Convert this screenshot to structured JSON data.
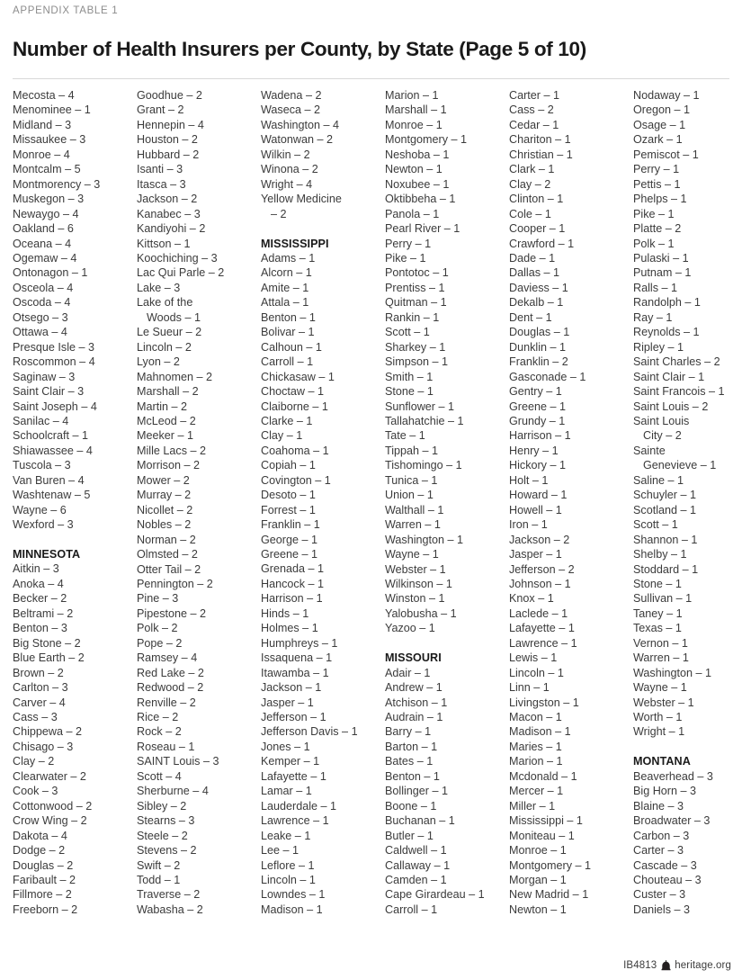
{
  "header": {
    "eyebrow": "APPENDIX TABLE 1",
    "title": "Number of Health Insurers per County, by State (Page 5 of 10)"
  },
  "footer": {
    "doc_id": "IB4813",
    "site": "heritage.org",
    "logo_icon": "heritage-bell-icon"
  },
  "columns": [
    {
      "id": "column-1",
      "entries": [
        {
          "text": "Mecosta – 4"
        },
        {
          "text": "Menominee – 1"
        },
        {
          "text": "Midland – 3"
        },
        {
          "text": "Missaukee – 3"
        },
        {
          "text": "Monroe – 4"
        },
        {
          "text": "Montcalm – 5"
        },
        {
          "text": "Montmorency – 3"
        },
        {
          "text": "Muskegon – 3"
        },
        {
          "text": "Newaygo – 4"
        },
        {
          "text": "Oakland – 6"
        },
        {
          "text": "Oceana – 4"
        },
        {
          "text": "Ogemaw – 4"
        },
        {
          "text": "Ontonagon – 1"
        },
        {
          "text": "Osceola – 4"
        },
        {
          "text": "Oscoda – 4"
        },
        {
          "text": "Otsego – 3"
        },
        {
          "text": "Ottawa – 4"
        },
        {
          "text": "Presque Isle – 3"
        },
        {
          "text": "Roscommon – 4"
        },
        {
          "text": "Saginaw – 3"
        },
        {
          "text": "Saint Clair – 3"
        },
        {
          "text": "Saint Joseph – 4"
        },
        {
          "text": "Sanilac – 4"
        },
        {
          "text": "Schoolcraft – 1"
        },
        {
          "text": "Shiawassee – 4"
        },
        {
          "text": "Tuscola – 3"
        },
        {
          "text": "Van Buren – 4"
        },
        {
          "text": "Washtenaw – 5"
        },
        {
          "text": "Wayne – 6"
        },
        {
          "text": "Wexford – 3"
        },
        {
          "type": "spacer",
          "text": ""
        },
        {
          "type": "state",
          "text": "MINNESOTA"
        },
        {
          "text": "Aitkin – 3"
        },
        {
          "text": "Anoka – 4"
        },
        {
          "text": "Becker – 2"
        },
        {
          "text": "Beltrami – 2"
        },
        {
          "text": "Benton – 3"
        },
        {
          "text": "Big Stone – 2"
        },
        {
          "text": "Blue Earth – 2"
        },
        {
          "text": "Brown – 2"
        },
        {
          "text": "Carlton – 3"
        },
        {
          "text": "Carver – 4"
        },
        {
          "text": "Cass – 3"
        },
        {
          "text": "Chippewa – 2"
        },
        {
          "text": "Chisago – 3"
        },
        {
          "text": "Clay – 2"
        },
        {
          "text": "Clearwater – 2"
        },
        {
          "text": "Cook – 3"
        },
        {
          "text": "Cottonwood – 2"
        },
        {
          "text": "Crow Wing – 2"
        },
        {
          "text": "Dakota – 4"
        },
        {
          "text": "Dodge – 2"
        },
        {
          "text": "Douglas – 2"
        },
        {
          "text": "Faribault – 2"
        },
        {
          "text": "Fillmore – 2"
        },
        {
          "text": "Freeborn – 2"
        }
      ]
    },
    {
      "id": "column-2",
      "entries": [
        {
          "text": "Goodhue – 2"
        },
        {
          "text": "Grant – 2"
        },
        {
          "text": "Hennepin – 4"
        },
        {
          "text": "Houston – 2"
        },
        {
          "text": "Hubbard – 2"
        },
        {
          "text": "Isanti – 3"
        },
        {
          "text": "Itasca – 3"
        },
        {
          "text": "Jackson – 2"
        },
        {
          "text": "Kanabec – 3"
        },
        {
          "text": "Kandiyohi – 2"
        },
        {
          "text": "Kittson – 1"
        },
        {
          "text": "Koochiching – 3"
        },
        {
          "text": "Lac Qui Parle – 2"
        },
        {
          "text": "Lake – 3"
        },
        {
          "text": "Lake of the"
        },
        {
          "type": "cont",
          "text": "Woods – 1"
        },
        {
          "text": "Le Sueur – 2"
        },
        {
          "text": "Lincoln – 2"
        },
        {
          "text": "Lyon – 2"
        },
        {
          "text": "Mahnomen – 2"
        },
        {
          "text": "Marshall – 2"
        },
        {
          "text": "Martin – 2"
        },
        {
          "text": "McLeod – 2"
        },
        {
          "text": "Meeker – 1"
        },
        {
          "text": "Mille Lacs – 2"
        },
        {
          "text": "Morrison – 2"
        },
        {
          "text": "Mower – 2"
        },
        {
          "text": "Murray – 2"
        },
        {
          "text": "Nicollet – 2"
        },
        {
          "text": "Nobles – 2"
        },
        {
          "text": "Norman – 2"
        },
        {
          "text": "Olmsted – 2"
        },
        {
          "text": "Otter Tail – 2"
        },
        {
          "text": "Pennington – 2"
        },
        {
          "text": "Pine – 3"
        },
        {
          "text": "Pipestone – 2"
        },
        {
          "text": "Polk – 2"
        },
        {
          "text": "Pope – 2"
        },
        {
          "text": "Ramsey – 4"
        },
        {
          "text": "Red Lake – 2"
        },
        {
          "text": "Redwood – 2"
        },
        {
          "text": "Renville – 2"
        },
        {
          "text": "Rice – 2"
        },
        {
          "text": "Rock – 2"
        },
        {
          "text": "Roseau – 1"
        },
        {
          "text": "SAINT Louis – 3"
        },
        {
          "text": "Scott – 4"
        },
        {
          "text": "Sherburne – 4"
        },
        {
          "text": "Sibley – 2"
        },
        {
          "text": "Stearns – 3"
        },
        {
          "text": "Steele – 2"
        },
        {
          "text": "Stevens – 2"
        },
        {
          "text": "Swift – 2"
        },
        {
          "text": "Todd – 1"
        },
        {
          "text": "Traverse – 2"
        },
        {
          "text": "Wabasha – 2"
        }
      ]
    },
    {
      "id": "column-3",
      "entries": [
        {
          "text": "Wadena – 2"
        },
        {
          "text": "Waseca – 2"
        },
        {
          "text": "Washington – 4"
        },
        {
          "text": "Watonwan – 2"
        },
        {
          "text": "Wilkin – 2"
        },
        {
          "text": "Winona – 2"
        },
        {
          "text": "Wright – 4"
        },
        {
          "text": "Yellow Medicine"
        },
        {
          "type": "cont",
          "text": "– 2"
        },
        {
          "type": "spacer",
          "text": ""
        },
        {
          "type": "state",
          "text": "MISSISSIPPI"
        },
        {
          "text": "Adams – 1"
        },
        {
          "text": "Alcorn – 1"
        },
        {
          "text": "Amite – 1"
        },
        {
          "text": "Attala – 1"
        },
        {
          "text": "Benton – 1"
        },
        {
          "text": "Bolivar – 1"
        },
        {
          "text": "Calhoun – 1"
        },
        {
          "text": "Carroll – 1"
        },
        {
          "text": "Chickasaw – 1"
        },
        {
          "text": "Choctaw – 1"
        },
        {
          "text": "Claiborne – 1"
        },
        {
          "text": "Clarke – 1"
        },
        {
          "text": "Clay – 1"
        },
        {
          "text": "Coahoma – 1"
        },
        {
          "text": "Copiah – 1"
        },
        {
          "text": "Covington – 1"
        },
        {
          "text": "Desoto – 1"
        },
        {
          "text": "Forrest – 1"
        },
        {
          "text": "Franklin – 1"
        },
        {
          "text": "George – 1"
        },
        {
          "text": "Greene – 1"
        },
        {
          "text": "Grenada – 1"
        },
        {
          "text": "Hancock – 1"
        },
        {
          "text": "Harrison – 1"
        },
        {
          "text": "Hinds – 1"
        },
        {
          "text": "Holmes – 1"
        },
        {
          "text": "Humphreys – 1"
        },
        {
          "text": "Issaquena – 1"
        },
        {
          "text": "Itawamba – 1"
        },
        {
          "text": "Jackson – 1"
        },
        {
          "text": "Jasper – 1"
        },
        {
          "text": "Jefferson – 1"
        },
        {
          "text": "Jefferson Davis – 1"
        },
        {
          "text": "Jones – 1"
        },
        {
          "text": "Kemper – 1"
        },
        {
          "text": "Lafayette – 1"
        },
        {
          "text": "Lamar – 1"
        },
        {
          "text": "Lauderdale – 1"
        },
        {
          "text": "Lawrence – 1"
        },
        {
          "text": "Leake – 1"
        },
        {
          "text": "Lee – 1"
        },
        {
          "text": "Leflore – 1"
        },
        {
          "text": "Lincoln – 1"
        },
        {
          "text": "Lowndes – 1"
        },
        {
          "text": "Madison – 1"
        }
      ]
    },
    {
      "id": "column-4",
      "entries": [
        {
          "text": "Marion – 1"
        },
        {
          "text": "Marshall – 1"
        },
        {
          "text": "Monroe – 1"
        },
        {
          "text": "Montgomery – 1"
        },
        {
          "text": "Neshoba – 1"
        },
        {
          "text": "Newton – 1"
        },
        {
          "text": "Noxubee – 1"
        },
        {
          "text": "Oktibbeha – 1"
        },
        {
          "text": "Panola – 1"
        },
        {
          "text": "Pearl River – 1"
        },
        {
          "text": "Perry – 1"
        },
        {
          "text": "Pike – 1"
        },
        {
          "text": "Pontotoc – 1"
        },
        {
          "text": "Prentiss – 1"
        },
        {
          "text": "Quitman – 1"
        },
        {
          "text": "Rankin – 1"
        },
        {
          "text": "Scott – 1"
        },
        {
          "text": "Sharkey – 1"
        },
        {
          "text": "Simpson – 1"
        },
        {
          "text": "Smith – 1"
        },
        {
          "text": "Stone – 1"
        },
        {
          "text": "Sunflower – 1"
        },
        {
          "text": "Tallahatchie – 1"
        },
        {
          "text": "Tate – 1"
        },
        {
          "text": "Tippah – 1"
        },
        {
          "text": "Tishomingo – 1"
        },
        {
          "text": "Tunica – 1"
        },
        {
          "text": "Union – 1"
        },
        {
          "text": "Walthall – 1"
        },
        {
          "text": "Warren – 1"
        },
        {
          "text": "Washington – 1"
        },
        {
          "text": "Wayne – 1"
        },
        {
          "text": "Webster – 1"
        },
        {
          "text": "Wilkinson – 1"
        },
        {
          "text": "Winston – 1"
        },
        {
          "text": "Yalobusha – 1"
        },
        {
          "text": "Yazoo – 1"
        },
        {
          "type": "spacer",
          "text": ""
        },
        {
          "type": "state",
          "text": "MISSOURI"
        },
        {
          "text": "Adair – 1"
        },
        {
          "text": "Andrew – 1"
        },
        {
          "text": "Atchison – 1"
        },
        {
          "text": "Audrain – 1"
        },
        {
          "text": "Barry – 1"
        },
        {
          "text": "Barton – 1"
        },
        {
          "text": "Bates – 1"
        },
        {
          "text": "Benton – 1"
        },
        {
          "text": "Bollinger – 1"
        },
        {
          "text": "Boone – 1"
        },
        {
          "text": "Buchanan – 1"
        },
        {
          "text": "Butler – 1"
        },
        {
          "text": "Caldwell – 1"
        },
        {
          "text": "Callaway – 1"
        },
        {
          "text": "Camden – 1"
        },
        {
          "text": "Cape Girardeau – 1"
        },
        {
          "text": "Carroll – 1"
        }
      ]
    },
    {
      "id": "column-5",
      "entries": [
        {
          "text": "Carter – 1"
        },
        {
          "text": "Cass – 2"
        },
        {
          "text": "Cedar – 1"
        },
        {
          "text": "Chariton – 1"
        },
        {
          "text": "Christian – 1"
        },
        {
          "text": "Clark – 1"
        },
        {
          "text": "Clay – 2"
        },
        {
          "text": "Clinton – 1"
        },
        {
          "text": "Cole – 1"
        },
        {
          "text": "Cooper – 1"
        },
        {
          "text": "Crawford – 1"
        },
        {
          "text": "Dade – 1"
        },
        {
          "text": "Dallas – 1"
        },
        {
          "text": "Daviess – 1"
        },
        {
          "text": "Dekalb – 1"
        },
        {
          "text": "Dent – 1"
        },
        {
          "text": "Douglas – 1"
        },
        {
          "text": "Dunklin – 1"
        },
        {
          "text": "Franklin – 2"
        },
        {
          "text": "Gasconade – 1"
        },
        {
          "text": "Gentry – 1"
        },
        {
          "text": "Greene – 1"
        },
        {
          "text": "Grundy – 1"
        },
        {
          "text": "Harrison – 1"
        },
        {
          "text": "Henry – 1"
        },
        {
          "text": "Hickory – 1"
        },
        {
          "text": "Holt – 1"
        },
        {
          "text": "Howard – 1"
        },
        {
          "text": "Howell – 1"
        },
        {
          "text": "Iron – 1"
        },
        {
          "text": "Jackson – 2"
        },
        {
          "text": "Jasper – 1"
        },
        {
          "text": "Jefferson – 2"
        },
        {
          "text": "Johnson – 1"
        },
        {
          "text": "Knox – 1"
        },
        {
          "text": "Laclede – 1"
        },
        {
          "text": "Lafayette – 1"
        },
        {
          "text": "Lawrence – 1"
        },
        {
          "text": "Lewis – 1"
        },
        {
          "text": "Lincoln – 1"
        },
        {
          "text": "Linn – 1"
        },
        {
          "text": "Livingston – 1"
        },
        {
          "text": "Macon – 1"
        },
        {
          "text": "Madison – 1"
        },
        {
          "text": "Maries – 1"
        },
        {
          "text": "Marion – 1"
        },
        {
          "text": "Mcdonald – 1"
        },
        {
          "text": "Mercer – 1"
        },
        {
          "text": "Miller – 1"
        },
        {
          "text": "Mississippi – 1"
        },
        {
          "text": "Moniteau – 1"
        },
        {
          "text": "Monroe – 1"
        },
        {
          "text": "Montgomery – 1"
        },
        {
          "text": "Morgan – 1"
        },
        {
          "text": "New Madrid – 1"
        },
        {
          "text": "Newton – 1"
        }
      ]
    },
    {
      "id": "column-6",
      "entries": [
        {
          "text": "Nodaway – 1"
        },
        {
          "text": "Oregon – 1"
        },
        {
          "text": "Osage – 1"
        },
        {
          "text": "Ozark – 1"
        },
        {
          "text": "Pemiscot – 1"
        },
        {
          "text": "Perry – 1"
        },
        {
          "text": "Pettis – 1"
        },
        {
          "text": "Phelps – 1"
        },
        {
          "text": "Pike – 1"
        },
        {
          "text": "Platte – 2"
        },
        {
          "text": "Polk – 1"
        },
        {
          "text": "Pulaski – 1"
        },
        {
          "text": "Putnam – 1"
        },
        {
          "text": "Ralls – 1"
        },
        {
          "text": "Randolph – 1"
        },
        {
          "text": "Ray – 1"
        },
        {
          "text": "Reynolds – 1"
        },
        {
          "text": "Ripley – 1"
        },
        {
          "text": "Saint Charles – 2"
        },
        {
          "text": "Saint Clair – 1"
        },
        {
          "text": "Saint Francois – 1"
        },
        {
          "text": "Saint Louis – 2"
        },
        {
          "text": "Saint Louis"
        },
        {
          "type": "cont",
          "text": "City – 2"
        },
        {
          "text": "Sainte"
        },
        {
          "type": "cont",
          "text": "Genevieve – 1"
        },
        {
          "text": "Saline – 1"
        },
        {
          "text": "Schuyler – 1"
        },
        {
          "text": "Scotland – 1"
        },
        {
          "text": "Scott – 1"
        },
        {
          "text": "Shannon – 1"
        },
        {
          "text": "Shelby – 1"
        },
        {
          "text": "Stoddard – 1"
        },
        {
          "text": "Stone – 1"
        },
        {
          "text": "Sullivan – 1"
        },
        {
          "text": "Taney – 1"
        },
        {
          "text": "Texas – 1"
        },
        {
          "text": "Vernon – 1"
        },
        {
          "text": "Warren – 1"
        },
        {
          "text": "Washington – 1"
        },
        {
          "text": "Wayne – 1"
        },
        {
          "text": "Webster – 1"
        },
        {
          "text": "Worth – 1"
        },
        {
          "text": "Wright – 1"
        },
        {
          "type": "spacer",
          "text": ""
        },
        {
          "type": "state",
          "text": "MONTANA"
        },
        {
          "text": "Beaverhead – 3"
        },
        {
          "text": "Big Horn – 3"
        },
        {
          "text": "Blaine – 3"
        },
        {
          "text": "Broadwater – 3"
        },
        {
          "text": "Carbon – 3"
        },
        {
          "text": "Carter – 3"
        },
        {
          "text": "Cascade – 3"
        },
        {
          "text": "Chouteau – 3"
        },
        {
          "text": "Custer – 3"
        },
        {
          "text": "Daniels – 3"
        }
      ]
    }
  ]
}
